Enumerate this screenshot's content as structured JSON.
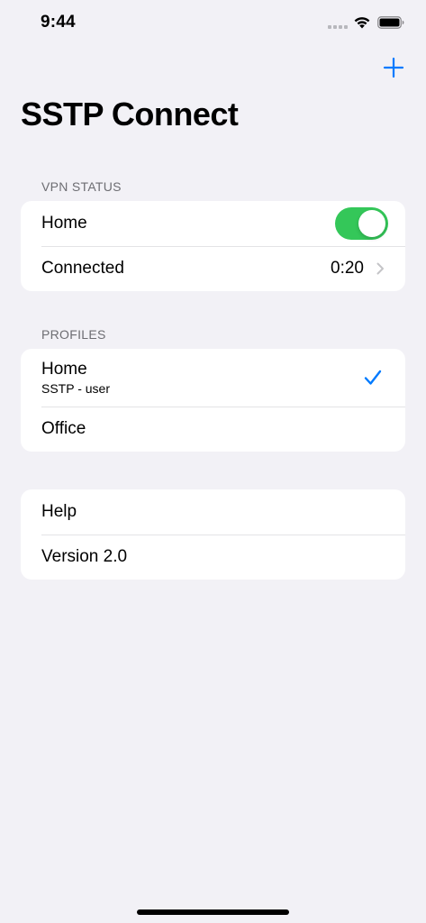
{
  "status_bar": {
    "time": "9:44"
  },
  "nav": {
    "title": "SSTP Connect",
    "add_icon": "plus-icon"
  },
  "vpn_status": {
    "header": "VPN STATUS",
    "profile_label": "Home",
    "toggle_on": true,
    "status_label": "Connected",
    "duration": "0:20"
  },
  "profiles": {
    "header": "PROFILES",
    "items": [
      {
        "name": "Home",
        "subtitle": "SSTP - user",
        "selected": true
      },
      {
        "name": "Office",
        "subtitle": "",
        "selected": false
      }
    ]
  },
  "misc": {
    "items": [
      {
        "label": "Help"
      },
      {
        "label": "Version 2.0"
      }
    ]
  },
  "colors": {
    "accent": "#007aff",
    "toggle_on": "#34c759",
    "background": "#f2f1f6",
    "chevron": "#c4c4c7"
  }
}
